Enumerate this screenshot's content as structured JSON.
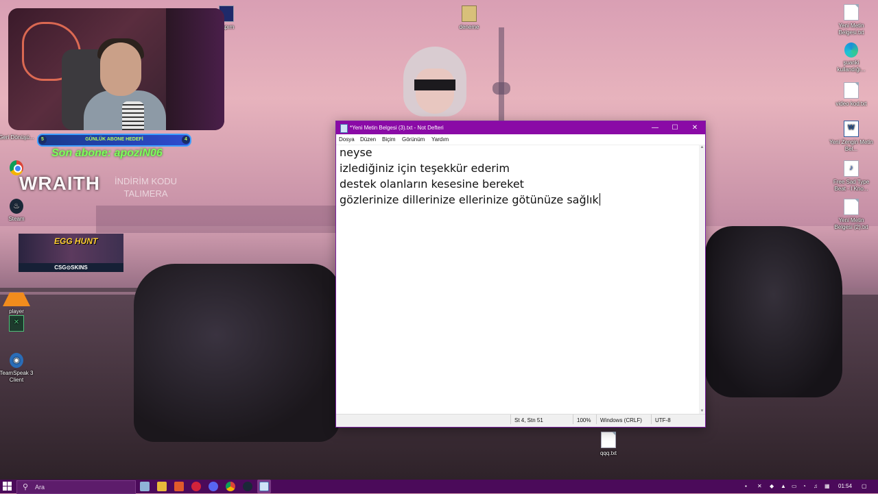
{
  "desktop": {
    "left_icons": [
      {
        "label": "Geri Dönüşü..."
      },
      {
        "label": "Google Chrome"
      },
      {
        "label": "Steam"
      },
      {
        "label": "qoosb..."
      },
      {
        "label": "player"
      },
      {
        "label": ""
      },
      {
        "label": "TeamSpeak 3 Client"
      }
    ],
    "top_icons": [
      {
        "label": "Yapım"
      },
      {
        "label": "deneme"
      }
    ],
    "right_icons": [
      {
        "label": "Yeni Metin Belgesi.txt"
      },
      {
        "label": "şuanki kullandığı..."
      },
      {
        "label": "video kod.txt"
      },
      {
        "label": "Yeni Zengin Metin Bel..."
      },
      {
        "label": "Free Sad Type Beat - I Kno..."
      },
      {
        "label": "Yeni Metin Belgesi (2).txt"
      }
    ],
    "bottom_icon": {
      "label": "qqq.txt"
    }
  },
  "overlay": {
    "sub_goal": {
      "left": "5",
      "label": "GÜNLÜK ABONE HEDEFİ",
      "right": "4"
    },
    "last_sub": "Son abone: apoziN06",
    "sponsor": "WRAITH",
    "sponsor_sub_line1": "İNDİRİM KODU",
    "sponsor_sub_line2": "TALIMERA",
    "csgo_title": "EGG HUNT",
    "csgo_brand": "CSG⊙SKINS"
  },
  "notepad": {
    "title": "*Yeni Metin Belgesi (3).txt - Not Defteri",
    "menu": [
      "Dosya",
      "Düzen",
      "Biçim",
      "Görünüm",
      "Yardım"
    ],
    "lines": [
      "neyse",
      "izlediğiniz için teşekkür ederim",
      "destek olanların kesesine bereket",
      "gözlerinize dillerinize ellerinize götünüze sağlık"
    ],
    "status": {
      "position": "St 4, Stn 51",
      "zoom": "100%",
      "line_ending": "Windows (CRLF)",
      "encoding": "UTF-8"
    }
  },
  "taskbar": {
    "search_placeholder": "Ara",
    "clock": "01:54"
  }
}
